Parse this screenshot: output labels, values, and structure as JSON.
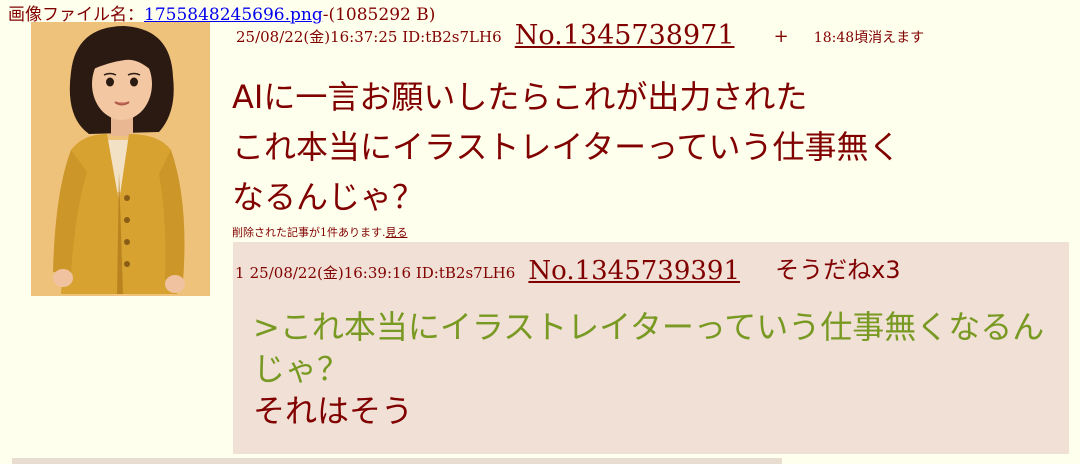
{
  "op": {
    "file_label": "画像ファイル名：",
    "file_name": "1755848245696.png",
    "file_size": "-(1085292 B)",
    "datetime_id": "25/08/22(金)16:37:25 ID:tB2s7LH6",
    "post_number": "No.1345738971",
    "plus": "+",
    "expire": "18:48頃消えます",
    "body_lines": [
      "AIに一言お願いしたらこれが出力された",
      "これ本当にイラストレイターっていう仕事無く",
      "なるんじゃ？"
    ],
    "deleted_note": "削除された記事が1件あります.",
    "deleted_link": "見る"
  },
  "reply": {
    "index": "1",
    "datetime_id": "25/08/22(金)16:39:16 ID:tB2s7LH6",
    "post_number": "No.1345739391",
    "sodane": "そうだねx3",
    "quote_lines": [
      ">これ本当にイラストレイターっていう仕事無くなるん",
      "じゃ？"
    ],
    "text": "それはそう"
  },
  "colors": {
    "background": "#ffffee",
    "reply_background": "#f0e0d6",
    "text": "#800000",
    "quote": "#789922",
    "link": "#0000ee"
  }
}
